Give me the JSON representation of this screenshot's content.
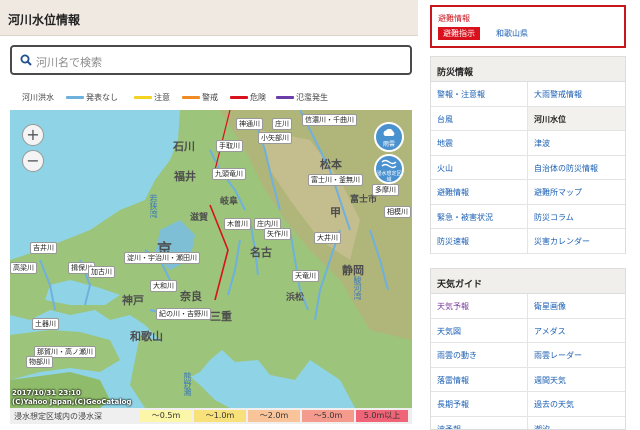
{
  "page": {
    "title": "河川水位情報"
  },
  "search": {
    "placeholder": "河川名で検索"
  },
  "legend": {
    "label": "河川洪水",
    "items": [
      {
        "label": "発表なし",
        "color": "#6fb1de"
      },
      {
        "label": "注意",
        "color": "#f3d31f"
      },
      {
        "label": "警戒",
        "color": "#f08a24"
      },
      {
        "label": "危険",
        "color": "#d8111c"
      },
      {
        "label": "氾濫発生",
        "color": "#6a3da8"
      }
    ]
  },
  "map": {
    "zoom_in": "+",
    "zoom_out": "−",
    "rain_button": "雨雲",
    "flood_button": "浸水想定区域",
    "timestamp": "2017/10/31 23:10",
    "copyright": "(C)Yahoo Japan,(C)GeoCatalog",
    "cities": [
      "石川",
      "福井",
      "松本",
      "京",
      "名古",
      "静岡",
      "神戸",
      "和歌山",
      "三重",
      "奈良",
      "浜松",
      "富士市",
      "甲",
      "滋賀",
      "岐阜"
    ],
    "seas": [
      "若狭湾",
      "駿河湾",
      "熊野灘"
    ],
    "river_tags": [
      "神通川",
      "庄川",
      "信濃川・千曲川",
      "手取川",
      "小矢部川",
      "九頭竜川",
      "富士川・釜無川",
      "多摩川",
      "相模川",
      "木曽川",
      "庄内川",
      "矢作川",
      "大井川",
      "天竜川",
      "淀川・宇治川・瀬田川",
      "大和川",
      "紀の川・吉野川",
      "吉井川",
      "揖保川",
      "加古川",
      "高梁川",
      "土器川",
      "那賀川・高ノ瀬川",
      "物部川"
    ]
  },
  "depth": {
    "label": "浸水想定区域内の浸水深",
    "bins": [
      {
        "label": "〜0.5m",
        "color": "#fbf6a8"
      },
      {
        "label": "〜1.0m",
        "color": "#f8e17b"
      },
      {
        "label": "〜2.0m",
        "color": "#f9c49a"
      },
      {
        "label": "〜5.0m",
        "color": "#f59b8e"
      },
      {
        "label": "5.0m以上",
        "color": "#ef6577"
      }
    ]
  },
  "alert": {
    "title": "避難情報",
    "tag": "避難指示",
    "prefecture": "和歌山県"
  },
  "disaster": {
    "header": "防災情報",
    "links": [
      "警報・注意報",
      "大雨警戒情報",
      "台風",
      "河川水位",
      "地震",
      "津波",
      "火山",
      "自治体の防災情報",
      "避難情報",
      "避難所マップ",
      "緊急・被害状況",
      "防災コラム",
      "防災速報",
      "災害カレンダー"
    ],
    "active_index": 3
  },
  "weather": {
    "header": "天気ガイド",
    "links": [
      "天気予報",
      "衛星画像",
      "天気図",
      "アメダス",
      "雨雲の動き",
      "雨雲レーダー",
      "落雷情報",
      "週間天気",
      "長期予報",
      "過去の天気",
      "波予報",
      "潮汐"
    ],
    "visited_index": 0
  }
}
